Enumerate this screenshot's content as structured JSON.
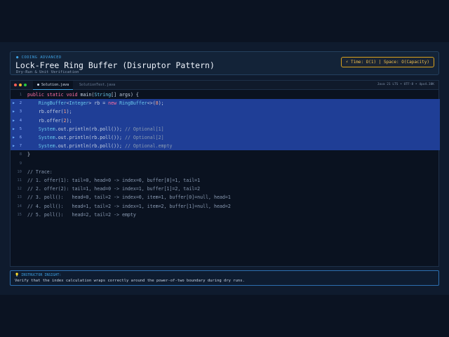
{
  "header": {
    "tag": "● CODING ADVANCED",
    "title": "Lock-Free Ring Buffer (Disruptor Pattern)",
    "subtitle": "Dry-Run & Unit Verification",
    "complexity": "⚡ Time: O(1) | Space: O(Capacity)"
  },
  "editor": {
    "tabs": [
      "● Solution.java",
      "SolutionTest.java"
    ],
    "status": "Java 21 LTS • UTF-8 • 4px4.38K",
    "highlight_color": "#1f3e96",
    "lines": [
      {
        "n": "1",
        "text": "public static void main(String[] args) {",
        "hl": false
      },
      {
        "n": "2",
        "text": "    RingBuffer<Integer> rb = new RingBuffer<>(8);",
        "hl": true
      },
      {
        "n": "3",
        "text": "    rb.offer(1);",
        "hl": true
      },
      {
        "n": "4",
        "text": "    rb.offer(2);",
        "hl": true
      },
      {
        "n": "5",
        "text": "    System.out.println(rb.poll()); // Optional[1]",
        "hl": true
      },
      {
        "n": "6",
        "text": "    System.out.println(rb.poll()); // Optional[2]",
        "hl": true
      },
      {
        "n": "7",
        "text": "    System.out.println(rb.poll()); // Optional.empty",
        "hl": true
      },
      {
        "n": "8",
        "text": "}",
        "hl": false
      },
      {
        "n": "9",
        "text": "",
        "hl": false
      },
      {
        "n": "10",
        "text": "// Trace:",
        "hl": false
      },
      {
        "n": "11",
        "text": "// 1. offer(1): tail=0, head=0 -> index=0, buffer[0]=1, tail=1",
        "hl": false
      },
      {
        "n": "12",
        "text": "// 2. offer(2): tail=1, head=0 -> index=1, buffer[1]=2, tail=2",
        "hl": false
      },
      {
        "n": "13",
        "text": "// 3. poll():   head=0, tail=2 -> index=0, item=1, buffer[0]=null, head=1",
        "hl": false
      },
      {
        "n": "14",
        "text": "// 4. poll():   head=1, tail=2 -> index=1, item=2, buffer[1]=null, head=2",
        "hl": false
      },
      {
        "n": "15",
        "text": "// 5. poll():   head=2, tail=2 -> empty",
        "hl": false
      }
    ]
  },
  "insight": {
    "label": "💡 INSTRUCTOR INSIGHT:",
    "text": "Verify that the index calculation wraps correctly around the power-of-two boundary during dry runs."
  }
}
